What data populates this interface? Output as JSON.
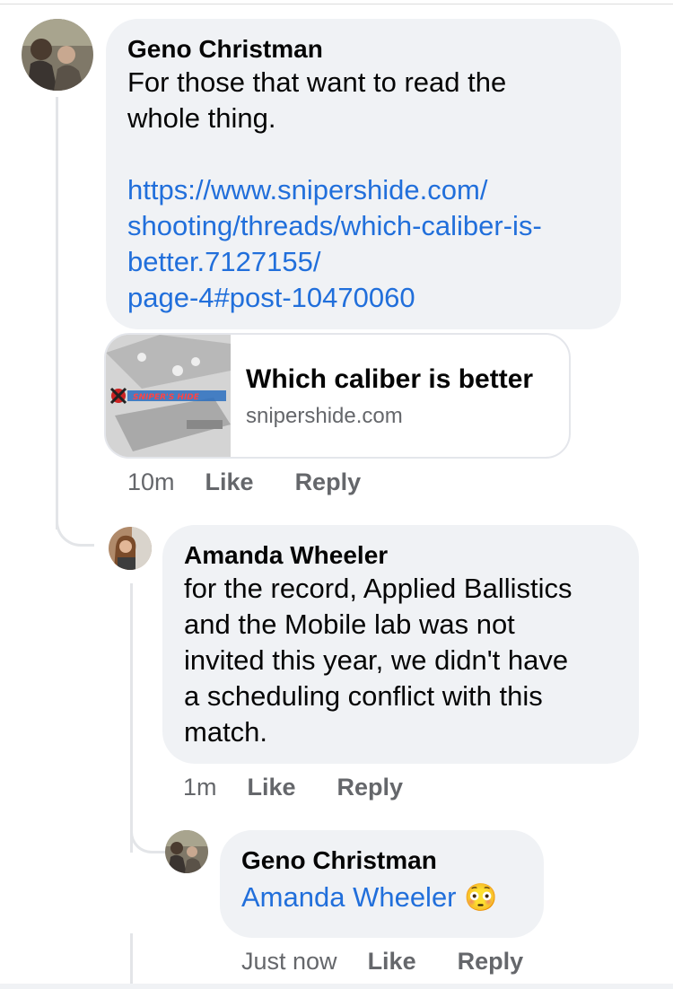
{
  "comments": [
    {
      "author": "Geno Christman",
      "text_line1": "For those that want to read the",
      "text_line2": "whole thing.",
      "link_lines": [
        "https://www.snipershide.com/",
        "shooting/threads/which-caliber-is-",
        "better.7127155/",
        "page-4#post-10470060"
      ],
      "preview": {
        "title": "Which caliber is better",
        "domain": "snipershide.com",
        "logo_text": "SNIPER'S HIDE"
      },
      "time": "10m",
      "like": "Like",
      "reply": "Reply"
    },
    {
      "author": "Amanda Wheeler",
      "lines": [
        "for the record, Applied Ballistics",
        "and the Mobile lab was not",
        "invited this year, we didn't have",
        "a scheduling conflict with this",
        "match."
      ],
      "time": "1m",
      "like": "Like",
      "reply": "Reply"
    },
    {
      "author": "Geno Christman",
      "mention": "Amanda Wheeler",
      "emoji": "😳",
      "time": "Just now",
      "like": "Like",
      "reply": "Reply"
    }
  ]
}
